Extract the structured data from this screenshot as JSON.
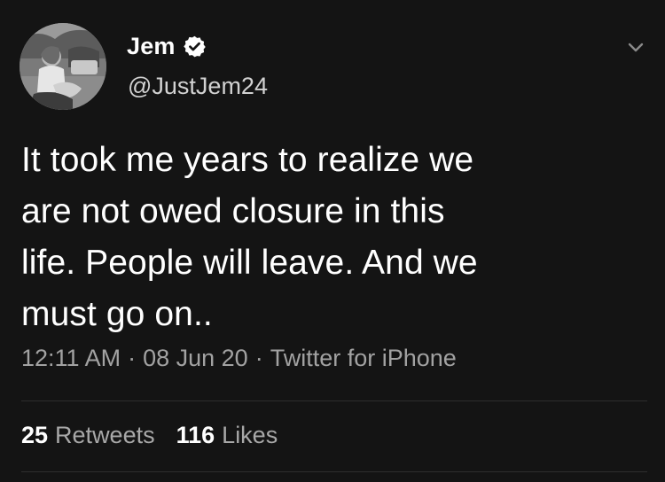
{
  "user": {
    "display_name": "Jem",
    "handle": "@JustJem24",
    "verified": true,
    "avatar_icon": "profile-photo"
  },
  "tweet": {
    "lines": [
      "It took me years to realize we",
      "are not owed closure in this",
      "life. People will leave. And we",
      "must go on.."
    ]
  },
  "meta": {
    "time": "12:11 AM",
    "separator_1": "·",
    "date": "08 Jun 20",
    "separator_2": "·",
    "source": "Twitter for iPhone"
  },
  "stats": {
    "retweets_count": "25",
    "retweets_label": "Retweets",
    "likes_count": "116",
    "likes_label": "Likes"
  },
  "icons": {
    "verified": "verified-badge-icon",
    "menu": "chevron-down-icon"
  },
  "colors": {
    "background": "#141414",
    "text_primary": "#ffffff",
    "text_secondary": "#a2a2a2",
    "divider": "#2e2e2e"
  }
}
